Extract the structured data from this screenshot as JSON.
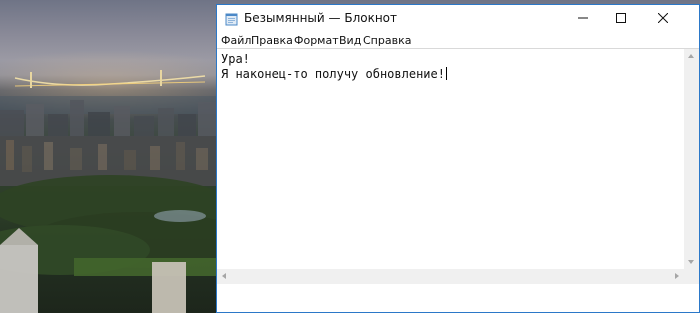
{
  "wallpaper": {
    "icon": "city-skyline-wallpaper"
  },
  "window": {
    "title": "Безымянный — Блокнот",
    "icon": "notepad-icon",
    "accent_color": "#2b78c8",
    "controls": {
      "minimize_icon": "minimize-icon",
      "maximize_icon": "maximize-icon",
      "close_icon": "close-icon"
    }
  },
  "menu": {
    "items": [
      {
        "label": "Файл"
      },
      {
        "label": "Правка"
      },
      {
        "label": "Формат"
      },
      {
        "label": "Вид"
      },
      {
        "label": "Справка"
      }
    ]
  },
  "editor": {
    "lines": [
      "Ура!",
      "Я наконец-то получу обновление!"
    ]
  }
}
